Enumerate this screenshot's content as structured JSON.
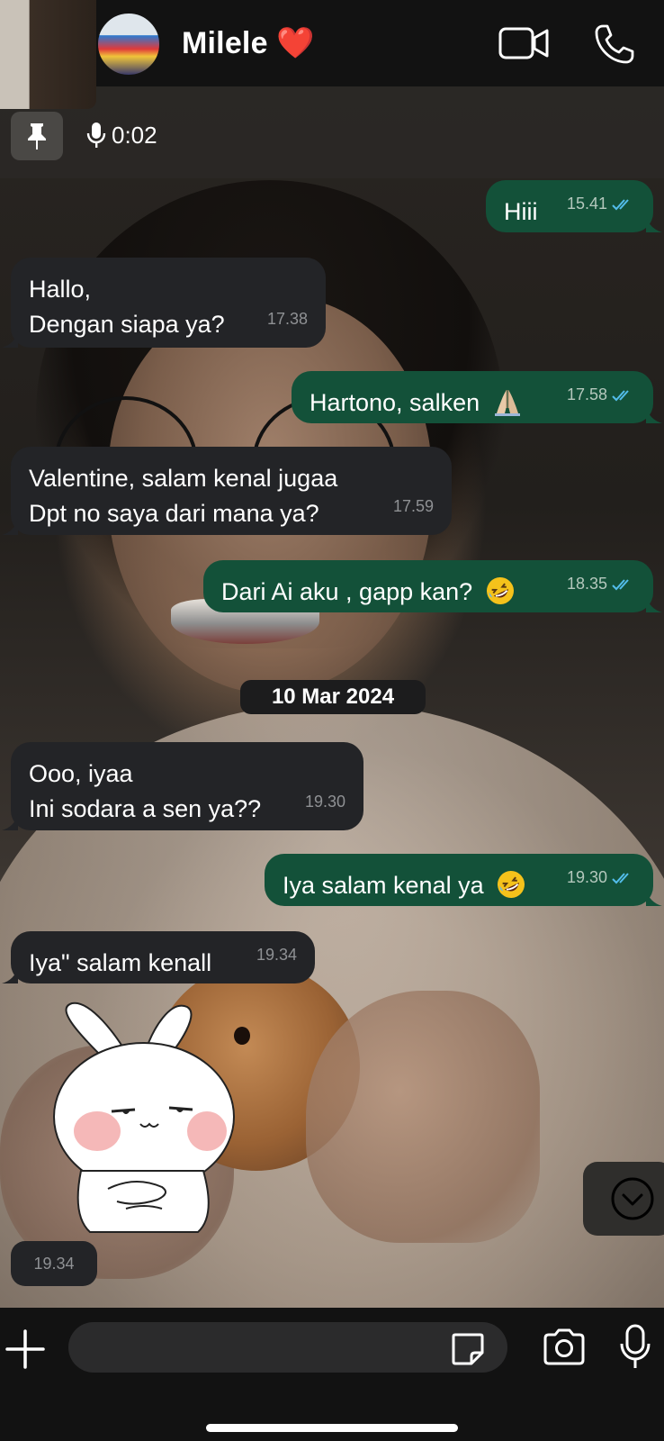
{
  "header": {
    "contact_name": "Milele",
    "name_emoji": "❤️"
  },
  "voice_bar": {
    "duration": "0:02"
  },
  "messages": [
    {
      "direction": "out",
      "lines": [
        "Hiii"
      ],
      "time": "15.41",
      "status": "read"
    },
    {
      "direction": "in",
      "lines": [
        "Hallo,",
        "Dengan siapa ya?"
      ],
      "time": "17.38"
    },
    {
      "direction": "out",
      "lines": [
        "Hartono, salken"
      ],
      "emoji": "🙏🏼",
      "time": "17.58",
      "status": "read"
    },
    {
      "direction": "in",
      "lines": [
        "Valentine, salam kenal jugaa",
        "Dpt no saya dari mana ya?"
      ],
      "time": "17.59"
    },
    {
      "direction": "out",
      "lines": [
        "Dari Ai aku , gapp kan?"
      ],
      "emoji": "🤣",
      "time": "18.35",
      "status": "read"
    },
    {
      "direction": "in",
      "lines": [
        "Ooo, iyaa",
        "Ini sodara a sen ya??"
      ],
      "time": "19.30"
    },
    {
      "direction": "out",
      "lines": [
        "Iya salam kenal ya"
      ],
      "emoji": "🤣",
      "time": "19.30",
      "status": "read"
    },
    {
      "direction": "in",
      "lines": [
        "Iya\" salam kenall"
      ],
      "time": "19.34"
    }
  ],
  "date_separator": "10 Mar 2024",
  "sticker": {
    "time": "19.34",
    "icon": "bunny-sticker-icon"
  },
  "composer": {
    "placeholder": ""
  },
  "colors": {
    "header_bg": "#121212",
    "incoming_bubble": "#232427",
    "outgoing_bubble": "#135139",
    "read_ticks": "#53bdeb",
    "heart": "#e8212e"
  }
}
